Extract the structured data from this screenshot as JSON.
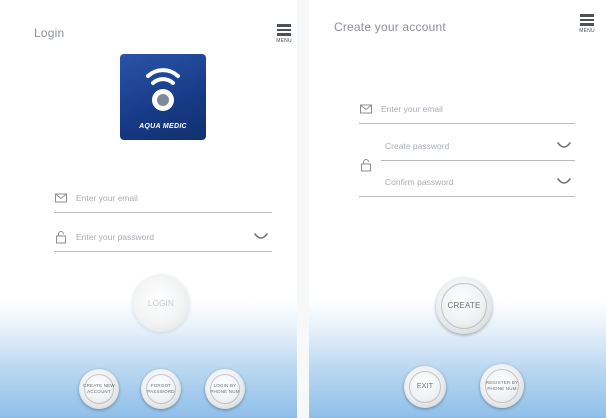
{
  "login": {
    "title": "Login",
    "menu_label": "MENU",
    "logo_text": "AQUA MEDIC",
    "email_placeholder": "Enter your email",
    "password_placeholder": "Enter your password",
    "login_button": "LOGIN",
    "bottom_buttons": [
      {
        "label": "CREATE NEW ACCOUNT"
      },
      {
        "label": "FORGOT PASSWORD"
      },
      {
        "label": "LOGIN BY PHONE NUM"
      }
    ]
  },
  "create": {
    "title": "Create your account",
    "menu_label": "MENU",
    "email_placeholder": "Enter your email",
    "create_password_placeholder": "Create password",
    "confirm_password_placeholder": "Confirm password",
    "create_button": "CREATE",
    "exit_button": "EXIT",
    "register_phone_button": "REGISTER BY PHONE NUM"
  },
  "colors": {
    "logo_blue": "#1a3f8c",
    "gradient_blue": "#8fbfe9",
    "text_gray": "#8a8f96"
  },
  "icons": [
    "menu-icon",
    "wifi-icon",
    "mail-icon",
    "lock-icon",
    "eye-icon"
  ]
}
